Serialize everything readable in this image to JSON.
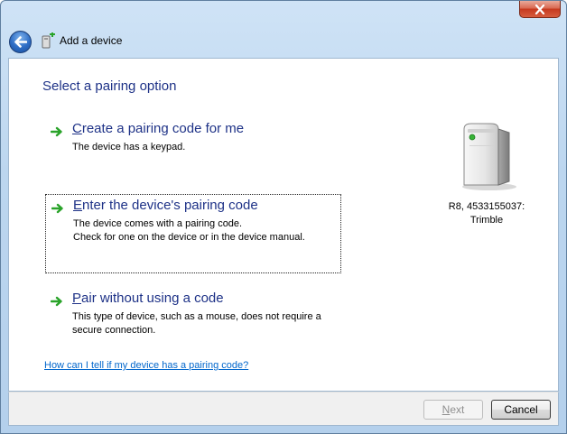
{
  "window": {
    "title": "Add a device",
    "close_glyph": "×"
  },
  "main": {
    "heading": "Select a pairing option",
    "options": [
      {
        "mnemonic": "C",
        "title_rest": "reate a pairing code for me",
        "desc_lines": [
          "The device has a keypad."
        ]
      },
      {
        "mnemonic": "E",
        "title_rest": "nter the device's pairing code",
        "desc_lines": [
          "The device comes with a pairing code.",
          "Check for one on the device or in the device manual."
        ]
      },
      {
        "mnemonic": "P",
        "title_rest": "air without using a code",
        "desc_lines": [
          "This type of device, such as a mouse, does not require a",
          "secure connection."
        ]
      }
    ],
    "device": {
      "name_line1": "R8, 4533155037:",
      "name_line2": "Trimble",
      "icon": "computer-tower-icon"
    },
    "help_link": "How can I tell if my device has a pairing code?"
  },
  "footer": {
    "next_mnemonic": "N",
    "next_rest": "ext",
    "cancel_label": "Cancel"
  },
  "colors": {
    "heading": "#1e3287",
    "link": "#0066cc",
    "arrow": "#2aa32a",
    "disabled_text": "#8f8f8f"
  }
}
